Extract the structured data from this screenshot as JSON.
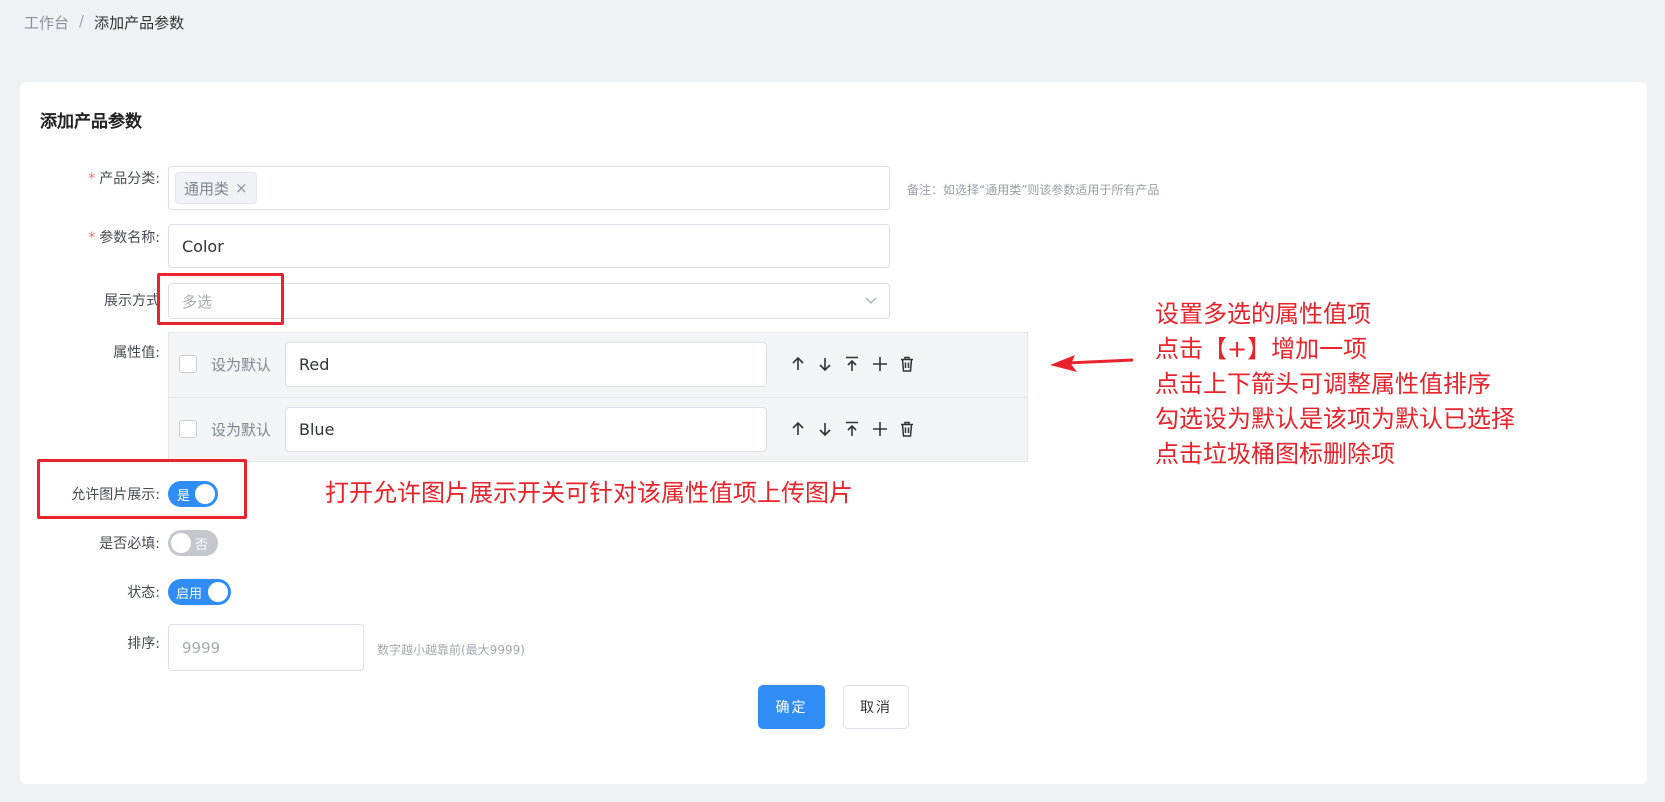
{
  "breadcrumb": {
    "home": "工作台",
    "separator": "/",
    "current": "添加产品参数"
  },
  "card": {
    "title": "添加产品参数"
  },
  "form": {
    "category": {
      "label": "产品分类:",
      "required_mark": "*",
      "tag": "通用类",
      "tag_close": "×",
      "hint": "备注：如选择“通用类”则该参数适用于所有产品"
    },
    "param_name": {
      "label": "参数名称:",
      "required_mark": "*",
      "value": "Color"
    },
    "display_mode": {
      "label": "展示方式",
      "placeholder": "多选"
    },
    "attr_values": {
      "label": "属性值:",
      "default_label": "设为默认",
      "items": [
        {
          "value": "Red"
        },
        {
          "value": "Blue"
        }
      ],
      "icons": [
        "arrow-up-icon",
        "arrow-down-icon",
        "move-top-icon",
        "plus-icon",
        "trash-icon"
      ]
    },
    "allow_image": {
      "label": "允许图片展示:",
      "state": "是"
    },
    "required": {
      "label": "是否必填:",
      "state": "否"
    },
    "status": {
      "label": "状态:",
      "state": "启用"
    },
    "sort": {
      "label": "排序:",
      "placeholder": "9999",
      "hint": "数字越小越靠前(最大9999)"
    },
    "confirm_label": "确定",
    "cancel_label": "取消"
  },
  "annotations": {
    "right": [
      "设置多选的属性值项",
      "点击【+】增加一项",
      "点击上下箭头可调整属性值排序",
      "勾选设为默认是该项为默认已选择",
      "点击垃圾桶图标删除项"
    ],
    "switch_note": "打开允许图片展示开关可针对该属性值项上传图片"
  },
  "colors": {
    "primary": "#2f8df5",
    "annotation_red": "#e8232b",
    "background": "#eff2f5"
  }
}
